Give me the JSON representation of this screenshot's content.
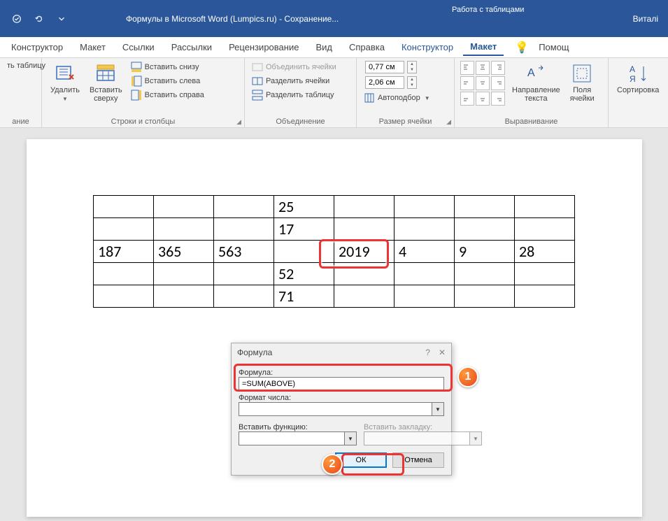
{
  "titlebar": {
    "doc_title": "Формулы в Microsoft Word (Lumpics.ru)  -  Сохранение... ",
    "context_tab": "Работа с таблицами",
    "user": "Виталі"
  },
  "tabs": {
    "konstruktor1": "Конструктор",
    "maket1": "Макет",
    "ssylki": "Ссылки",
    "rassylki": "Рассылки",
    "recenz": "Рецензирование",
    "vid": "Вид",
    "spravka": "Справка",
    "konstruktor2": "Конструктор",
    "maket2": "Макет",
    "help": "Помощ"
  },
  "ribbon": {
    "draw_table": "ть таблицу",
    "group_drawing": "ание",
    "delete": "Удалить",
    "insert_above": "Вставить\nсверху",
    "insert_below": "Вставить снизу",
    "insert_left": "Вставить слева",
    "insert_right": "Вставить справа",
    "group_rows_cols": "Строки и столбцы",
    "merge_cells": "Объединить ячейки",
    "split_cells": "Разделить ячейки",
    "split_table": "Разделить таблицу",
    "group_merge": "Объединение",
    "height": "0,77 см",
    "width": "2,06 см",
    "autofit": "Автоподбор",
    "group_cell_size": "Размер ячейки",
    "text_direction": "Направление\nтекста",
    "cell_margins": "Поля\nячейки",
    "group_alignment": "Выравнивание",
    "sort": "Сортировка"
  },
  "table": {
    "r0": [
      "",
      "",
      "",
      "25",
      "",
      "",
      "",
      ""
    ],
    "r1": [
      "",
      "",
      "",
      "17",
      "",
      "",
      "",
      ""
    ],
    "r2": [
      "187",
      "365",
      "563",
      "",
      "2019",
      "4",
      "9",
      "28"
    ],
    "r3": [
      "",
      "",
      "",
      "52",
      "",
      "",
      "",
      ""
    ],
    "r4": [
      "",
      "",
      "",
      "71",
      "",
      "",
      "",
      ""
    ]
  },
  "dialog": {
    "title": "Формула",
    "formula_label": "Формула:",
    "formula_value": "=SUM(ABOVE)",
    "number_format_label": "Формат числа:",
    "insert_function_label": "Вставить функцию:",
    "insert_bookmark_label": "Вставить закладку:",
    "ok": "ОК",
    "cancel": "Отмена"
  },
  "badges": {
    "one": "1",
    "two": "2"
  }
}
